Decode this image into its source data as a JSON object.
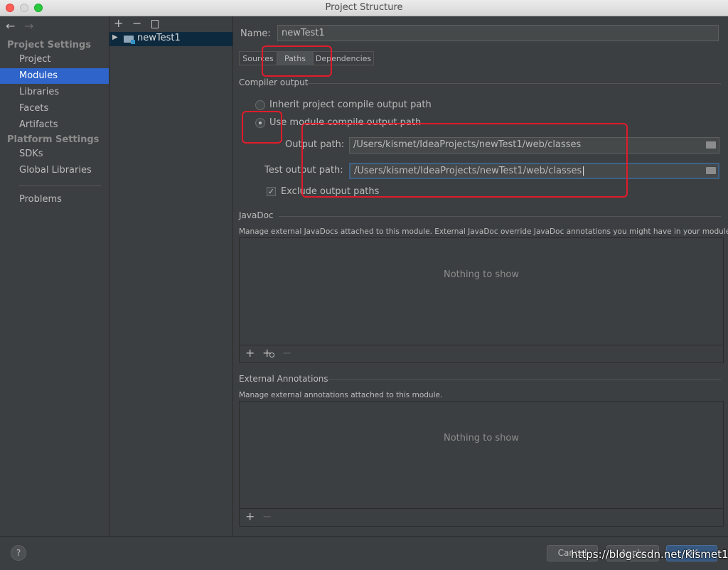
{
  "window": {
    "title": "Project Structure"
  },
  "sidebar": {
    "project_settings": "Project Settings",
    "items_top": [
      "Project",
      "Modules",
      "Libraries",
      "Facets",
      "Artifacts"
    ],
    "platform_settings": "Platform Settings",
    "items_platform": [
      "SDKs",
      "Global Libraries"
    ],
    "problems": "Problems",
    "selected": "Modules"
  },
  "tree": {
    "module": "newTest1"
  },
  "content": {
    "name_label": "Name:",
    "name_value": "newTest1",
    "tabs": [
      "Sources",
      "Paths",
      "Dependencies"
    ],
    "active_tab": "Paths",
    "compiler_output": "Compiler output",
    "inherit_label": "Inherit project compile output path",
    "use_module_label": "Use module compile output path",
    "output_path_label": "Output path:",
    "output_path_value": "/Users/kismet/IdeaProjects/newTest1/web/classes",
    "test_output_label": "Test output path:",
    "test_output_value": "/Users/kismet/IdeaProjects/newTest1/web/classes",
    "exclude_label": "Exclude output paths",
    "javadoc_title": "JavaDoc",
    "javadoc_desc": "Manage external JavaDocs attached to this module. External JavaDoc override JavaDoc annotations you might have in your module.",
    "nothing_to_show": "Nothing to show",
    "ext_annot_title": "External Annotations",
    "ext_annot_desc": "Manage external annotations attached to this module."
  },
  "footer": {
    "help": "?",
    "cancel": "Cancel",
    "apply": "Apply",
    "ok": "OK",
    "watermark": "https://blog.csdn.net/Kismet11"
  },
  "colors": {
    "accent": "#2f65ca",
    "annotation": "#e11b2a"
  }
}
